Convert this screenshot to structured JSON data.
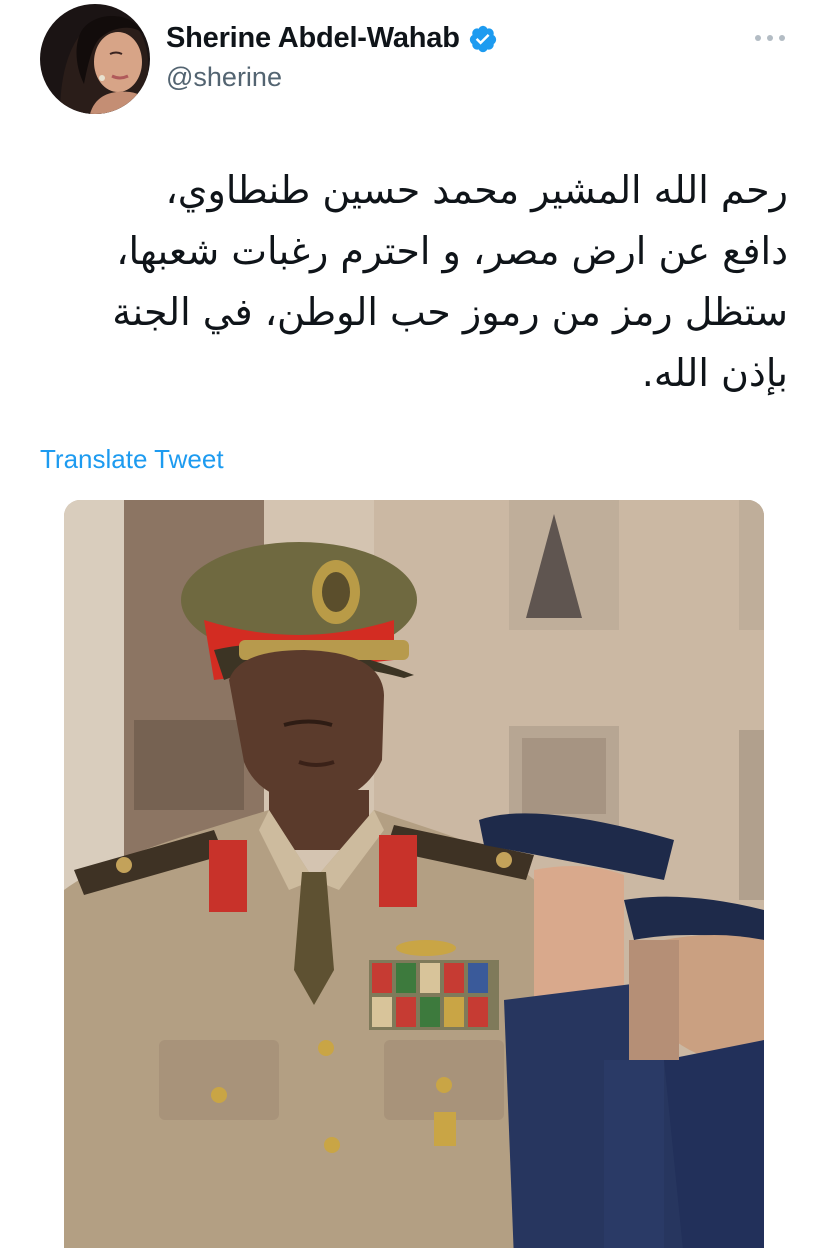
{
  "author": {
    "display_name": "Sherine Abdel-Wahab",
    "handle": "@sherine",
    "verified": true,
    "verified_icon": "verified-badge-icon",
    "avatar_icon": "profile-photo"
  },
  "tweet": {
    "text_lines": [
      "رحم الله المشير محمد حسين طنطاوي،",
      "دافع عن ارض مصر، و احترم رغبات شعبها،",
      "ستظل رمز من رموز حب الوطن، في الجنة",
      "بإذن الله."
    ],
    "translate_label": "Translate Tweet",
    "more_icon": "more-options-icon"
  },
  "media": {
    "kind": "photo"
  },
  "colors": {
    "link": "#1d9bf0",
    "verified": "#1d9bf0",
    "secondary_text": "#536471",
    "primary_text": "#0f1419"
  }
}
